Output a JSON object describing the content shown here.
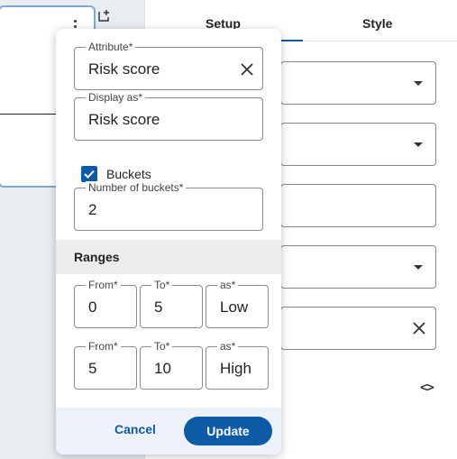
{
  "panel": {
    "tabs": [
      {
        "label": "Setup",
        "active": true
      },
      {
        "label": "Style",
        "active": false
      }
    ]
  },
  "popup": {
    "attribute": {
      "label": "Attribute*",
      "value": "Risk score"
    },
    "display_as": {
      "label": "Display as*",
      "value": "Risk score"
    },
    "buckets": {
      "label": "Buckets",
      "checked": true
    },
    "number_of_buckets": {
      "label": "Number of buckets*",
      "value": "2"
    },
    "ranges": {
      "title": "Ranges",
      "rows": [
        {
          "from_label": "From*",
          "from": "0",
          "to_label": "To*",
          "to": "5",
          "as_label": "as*",
          "as": "Low"
        },
        {
          "from_label": "From*",
          "from": "5",
          "to_label": "To*",
          "to": "10",
          "as_label": "as*",
          "as": "High"
        }
      ]
    },
    "footer": {
      "cancel_label": "Cancel",
      "update_label": "Update"
    }
  },
  "colors": {
    "accent": "#0d5aa7",
    "footer_bg": "#edf2f8",
    "ranges_bg": "#ececec"
  }
}
